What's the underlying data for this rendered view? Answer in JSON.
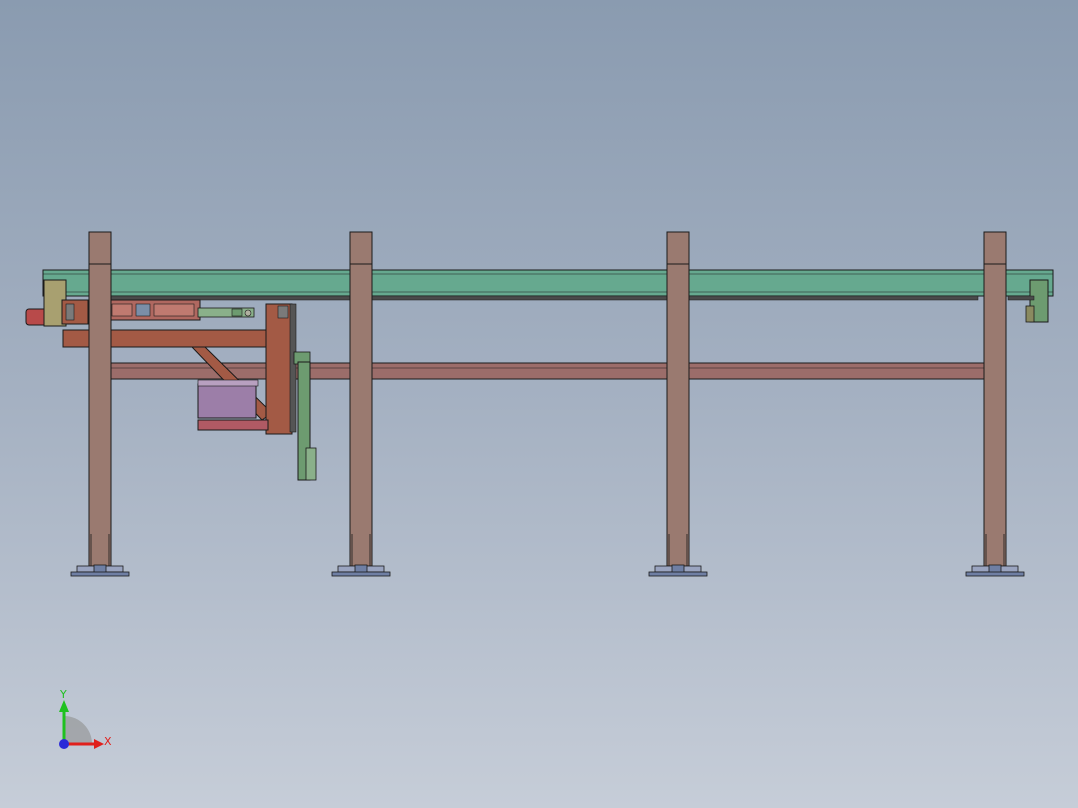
{
  "triad": {
    "x_label": "X",
    "y_label": "Y",
    "x_color": "#e0201c",
    "y_color": "#1fc11f",
    "z_color": "#2a2ad8"
  },
  "colors": {
    "background_top": "#8a9bb0",
    "background_bottom": "#c6cdd8",
    "column": "#9a7a70",
    "rail": "#66a98f",
    "beam": "#9c6d6a",
    "carriage_frame": "#a35a45",
    "motor": "#9c7ea8",
    "green_parts": "#6d9b70",
    "base_plate": "#6f7fa4",
    "outline": "#1a1a1a"
  },
  "model": {
    "column_count": 4,
    "icons": [
      "gantry-frame-icon",
      "coordinate-triad-icon"
    ]
  }
}
